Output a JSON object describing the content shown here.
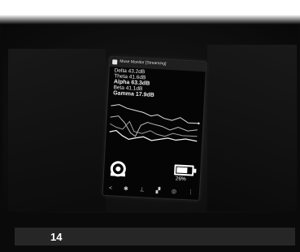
{
  "app": {
    "title": "Muse Monitor [Streaming]"
  },
  "bands": [
    {
      "label": "Delta 43.2dB"
    },
    {
      "label": "Theta 41.6dB"
    },
    {
      "label": "Alpha 63.3dB"
    },
    {
      "label": "Beta 41.1dB"
    },
    {
      "label": "Gamma 17.9dB"
    }
  ],
  "battery": {
    "percent_label": "26%",
    "level": 0.26
  },
  "toolbar_icons": [
    "share-icon",
    "settings-icon",
    "marker-icon",
    "record-icon",
    "target-icon",
    "more-icon"
  ],
  "caption": {
    "page_number": "14"
  },
  "colors": {
    "background": "#0a0a0a",
    "caption_bar": "#262626",
    "text": "#ffffff"
  }
}
